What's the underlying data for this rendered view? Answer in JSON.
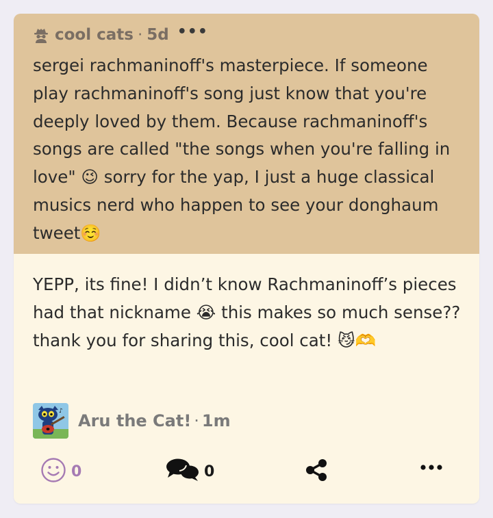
{
  "question": {
    "sender": "cool cats",
    "separator": "·",
    "age": "5d",
    "more": "•••",
    "text": "sergei rachmaninoff's masterpiece. If someone play rachmaninoff's song just know that you're deeply loved by them. Because rachmaninoff's songs are called \"the songs when you're falling in love\" 😉 sorry for the yap, I just a huge classical musics nerd who happen to see your donghaum tweet☺️",
    "sender_icon": "spy-icon"
  },
  "answer": {
    "text": "YEPP, its fine! I didn’t know Rachmaninoff’s pieces had that nickname 😭 this makes so much sense?? thank you for sharing this, cool cat! 😼🫶"
  },
  "author": {
    "name": "Aru the Cat!",
    "separator": "·",
    "age": "1m",
    "avatar_icon": "cat-guitar-avatar"
  },
  "actions": {
    "react_count": "0",
    "comment_count": "0",
    "react_icon": "smile-icon",
    "comment_icon": "comments-icon",
    "share_icon": "share-icon",
    "more_icon": "more-icon",
    "more_label": "•••"
  },
  "colors": {
    "background": "#efedf4",
    "question_bg": "#dfc49b",
    "answer_bg": "#fdf6e4",
    "react_accent": "#a57ab3",
    "muted_text": "#7a6e63"
  }
}
